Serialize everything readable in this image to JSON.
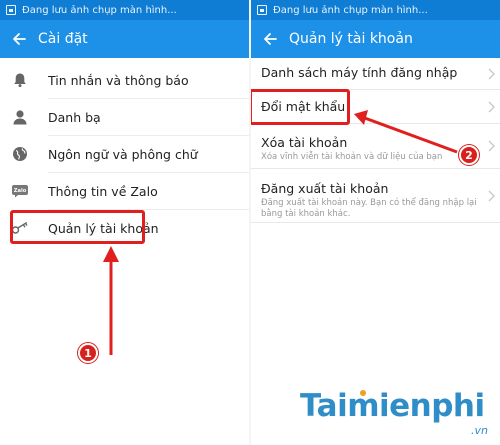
{
  "colors": {
    "statusbar": "#0f7dd4",
    "appbar": "#1d90e8",
    "highlight": "#e0201e",
    "watermark": "#2f8ec7"
  },
  "left": {
    "status_text": "Đang lưu ảnh chụp màn hình...",
    "title": "Cài đặt",
    "items": [
      {
        "label": "Tin nhắn và thông báo",
        "icon": "bell-icon"
      },
      {
        "label": "Danh bạ",
        "icon": "person-icon"
      },
      {
        "label": "Ngôn ngữ và phông chữ",
        "icon": "globe-icon"
      },
      {
        "label": "Thông tin về Zalo",
        "icon": "zalo-icon",
        "icon_text": "Zalo"
      },
      {
        "label": "Quản lý tài khoản",
        "icon": "key-icon"
      }
    ]
  },
  "right": {
    "status_text": "Đang lưu ảnh chụp màn hình...",
    "title": "Quản lý tài khoản",
    "items": [
      {
        "title": "Danh sách máy tính đăng nhập",
        "subtitle": ""
      },
      {
        "title": "Đổi mật khẩu",
        "subtitle": ""
      },
      {
        "title": "Xóa tài khoản",
        "subtitle": "Xóa vĩnh viễn tài khoản và dữ liệu của bạn"
      },
      {
        "title": "Đăng xuất tài khoản",
        "subtitle": "Đăng xuất tài khoản này. Bạn có thể đăng nhập lại bằng tài khoản khác."
      }
    ]
  },
  "annotations": {
    "step1": "1",
    "step2": "2"
  },
  "watermark": {
    "name": "Taimienphi",
    "tld": ".vn"
  }
}
